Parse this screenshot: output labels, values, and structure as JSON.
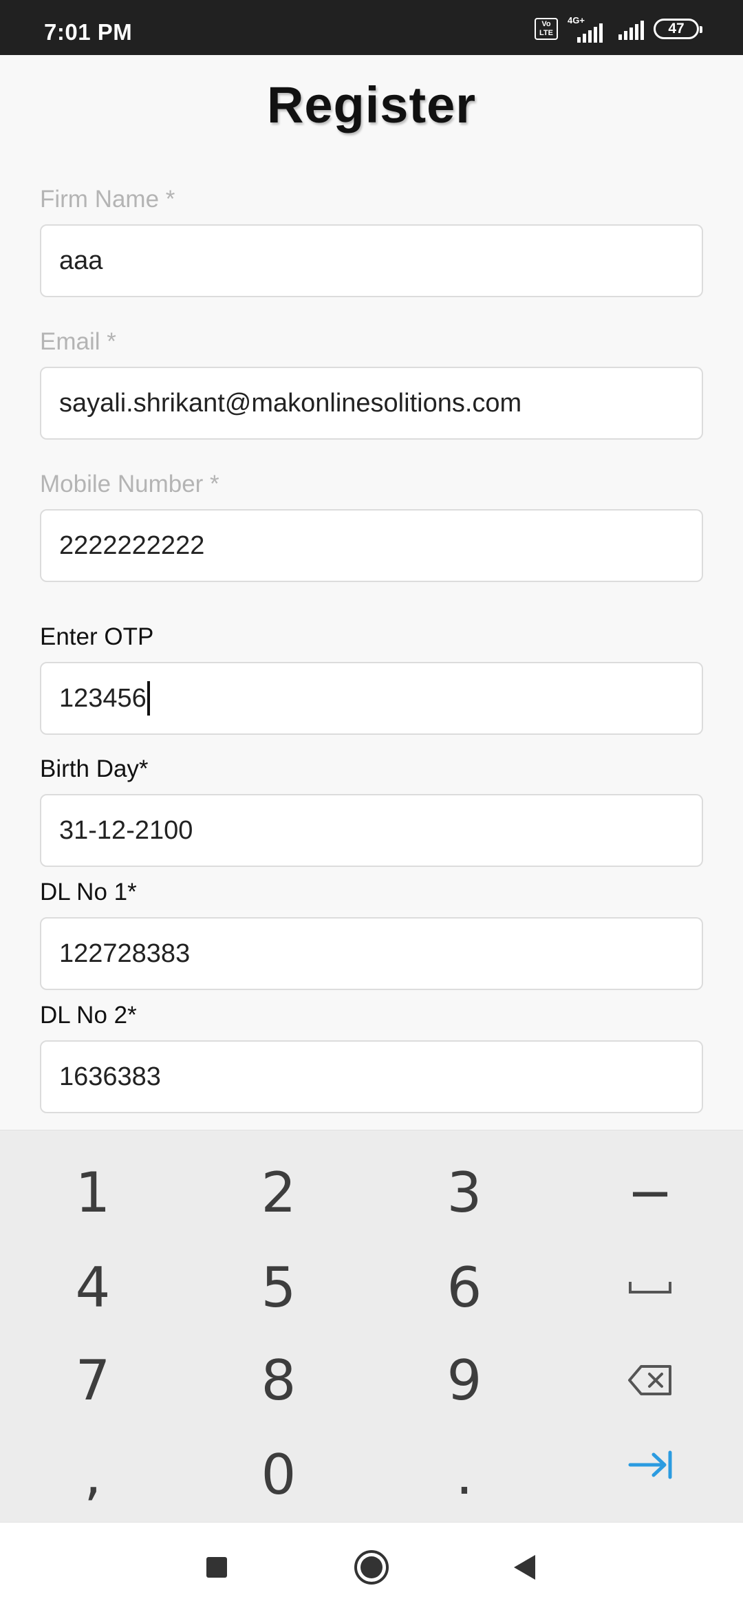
{
  "status_bar": {
    "time": "7:01 PM",
    "volte": "Vo LTE",
    "network": "4G+",
    "battery": "47"
  },
  "page": {
    "title": "Register"
  },
  "form": {
    "firm_name": {
      "label": "Firm Name *",
      "value": "aaa"
    },
    "email": {
      "label": "Email *",
      "value": "sayali.shrikant@makonlinesolitions.com"
    },
    "mobile": {
      "label": "Mobile Number *",
      "value": "2222222222"
    },
    "otp": {
      "label": "Enter OTP",
      "value": "123456"
    },
    "birthday": {
      "label": "Birth Day*",
      "value": "31-12-2100"
    },
    "dl1": {
      "label": "DL No 1*",
      "value": "122728383"
    },
    "dl2": {
      "label": "DL No 2*",
      "value": "1636383"
    }
  },
  "keyboard": {
    "keys": [
      "1",
      "2",
      "3",
      "−",
      "4",
      "5",
      "6",
      "",
      "7",
      "8",
      "9",
      "",
      ",",
      "0",
      ".",
      ""
    ],
    "icons": {
      "space": "space-icon",
      "backspace": "backspace-icon",
      "next": "tab-next-icon"
    },
    "accent": "#2b9be0"
  },
  "nav_bar": {
    "icons": [
      "recents-square-icon",
      "home-circle-icon",
      "back-triangle-icon"
    ]
  }
}
